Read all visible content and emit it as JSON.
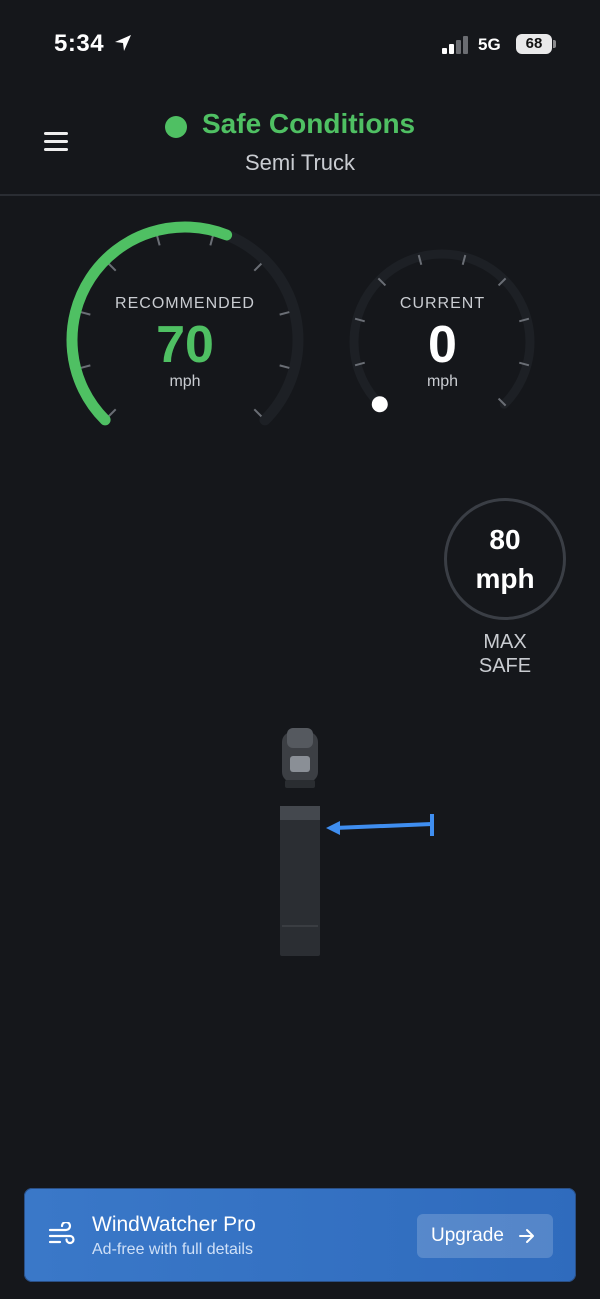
{
  "status_bar": {
    "time": "5:34",
    "network": "5G",
    "battery": "68"
  },
  "header": {
    "status": "Safe Conditions",
    "vehicle": "Semi Truck"
  },
  "gauges": {
    "recommended": {
      "label": "RECOMMENDED",
      "value": "70",
      "unit": "mph",
      "fill_fraction": 0.58
    },
    "current": {
      "label": "CURRENT",
      "value": "0",
      "unit": "mph",
      "fill_fraction": 0.0
    }
  },
  "max_safe": {
    "value": "80",
    "unit": "mph",
    "label_line1": "MAX",
    "label_line2": "SAFE"
  },
  "banner": {
    "title": "WindWatcher Pro",
    "subtitle": "Ad-free with full details",
    "button": "Upgrade"
  },
  "colors": {
    "background": "#15171b",
    "safe_green": "#4fc063",
    "wind_blue": "#3f8ef0",
    "banner_blue": "#3a78c8"
  }
}
